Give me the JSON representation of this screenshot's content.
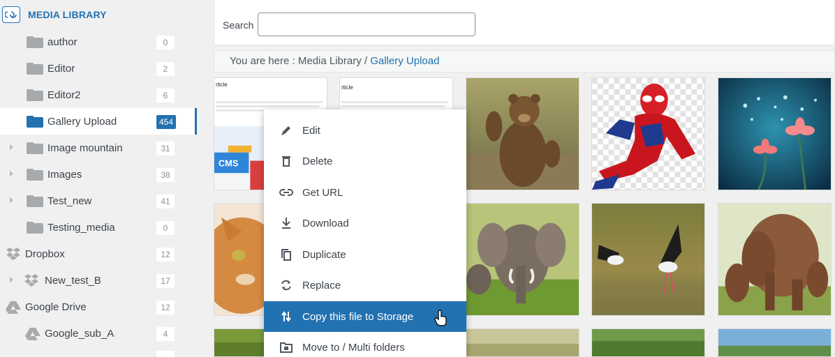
{
  "sidebar": {
    "title": "MEDIA LIBRARY",
    "items": [
      {
        "label": "author",
        "count": "0"
      },
      {
        "label": "Editor",
        "count": "2"
      },
      {
        "label": "Editor2",
        "count": "6"
      },
      {
        "label": "Gallery Upload",
        "count": "454"
      },
      {
        "label": "Image mountain",
        "count": "31"
      },
      {
        "label": "Images",
        "count": "38"
      },
      {
        "label": "Test_new",
        "count": "41"
      },
      {
        "label": "Testing_media",
        "count": "0"
      },
      {
        "label": "Dropbox",
        "count": "12"
      },
      {
        "label": "New_test_B",
        "count": "17"
      },
      {
        "label": "Google Drive",
        "count": "12"
      },
      {
        "label": "Google_sub_A",
        "count": "4"
      }
    ]
  },
  "search": {
    "label": "Search",
    "value": "",
    "placeholder": ""
  },
  "breadcrumb": {
    "prefix": "You are here  :  Media Library  /",
    "current": "Gallery Upload"
  },
  "thumbnails": {
    "article_title": "rticle",
    "article_title_2": "rticle",
    "cms_badge": "CMS"
  },
  "context_menu": {
    "items": [
      {
        "label": "Edit",
        "icon": "pencil-icon"
      },
      {
        "label": "Delete",
        "icon": "trash-icon"
      },
      {
        "label": "Get URL",
        "icon": "link-icon"
      },
      {
        "label": "Download",
        "icon": "download-icon"
      },
      {
        "label": "Duplicate",
        "icon": "duplicate-icon"
      },
      {
        "label": "Replace",
        "icon": "replace-icon"
      },
      {
        "label": "Copy this file to Storage",
        "icon": "copy-storage-icon"
      },
      {
        "label": "Move to / Multi folders",
        "icon": "move-folder-icon"
      }
    ]
  },
  "colors": {
    "accent": "#2271b1",
    "folder": "#8c8f94",
    "folder_active": "#2271b1"
  }
}
